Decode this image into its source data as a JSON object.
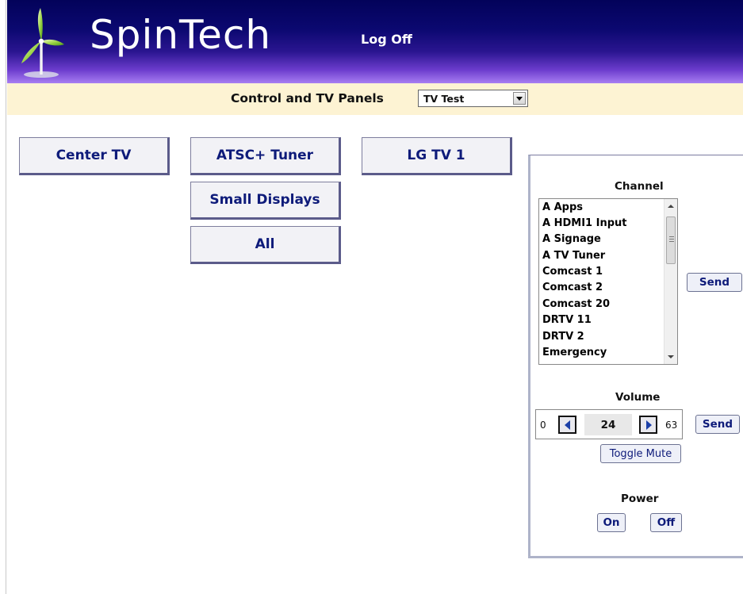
{
  "header": {
    "brand": "SpinTech",
    "logoff_label": "Log Off",
    "logo_icon": "wind-turbine-icon"
  },
  "toolbar": {
    "label": "Control and TV Panels",
    "selected_panel": "TV Test"
  },
  "panels": {
    "center_tv": "Center TV",
    "atsc_tuner": "ATSC+ Tuner",
    "lg_tv_1": "LG TV 1",
    "small_displays": "Small Displays",
    "all": "All"
  },
  "control": {
    "channel_label": "Channel",
    "channels": [
      "A Apps",
      "A HDMI1 Input",
      "A Signage",
      "A TV Tuner",
      "Comcast 1",
      "Comcast 2",
      "Comcast 20",
      "DRTV 11",
      "DRTV 2",
      "Emergency"
    ],
    "channel_send_label": "Send",
    "volume_label": "Volume",
    "volume_min": "0",
    "volume_value": "24",
    "volume_max": "63",
    "volume_send_label": "Send",
    "toggle_mute_label": "Toggle Mute",
    "power_label": "Power",
    "power_on_label": "On",
    "power_off_label": "Off"
  },
  "colors": {
    "header_dark": "#03025a",
    "header_light": "#a87ef2",
    "toolbar_bg": "#fdf3d3",
    "button_text": "#0e1b7a"
  }
}
